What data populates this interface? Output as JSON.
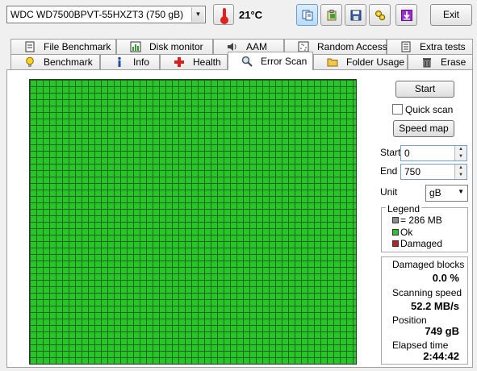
{
  "toolbar": {
    "drive": "WDC WD7500BPVT-55HXZT3 (750 gB)",
    "temperature": "21°C",
    "exit_label": "Exit"
  },
  "tabs_top": [
    {
      "label": "File Benchmark",
      "icon": "file-benchmark-icon"
    },
    {
      "label": "Disk monitor",
      "icon": "disk-monitor-icon"
    },
    {
      "label": "AAM",
      "icon": "speaker-icon"
    },
    {
      "label": "Random Access",
      "icon": "random-access-icon"
    },
    {
      "label": "Extra tests",
      "icon": "extra-tests-icon"
    }
  ],
  "tabs_bottom": [
    {
      "label": "Benchmark",
      "icon": "lightbulb-icon"
    },
    {
      "label": "Info",
      "icon": "info-icon"
    },
    {
      "label": "Health",
      "icon": "red-cross-icon"
    },
    {
      "label": "Error Scan",
      "icon": "magnifier-icon",
      "active": true
    },
    {
      "label": "Folder Usage",
      "icon": "folder-icon"
    },
    {
      "label": "Erase",
      "icon": "trash-icon"
    }
  ],
  "scan": {
    "start_button": "Start",
    "quick_scan_label": "Quick scan",
    "quick_scan_checked": false,
    "speed_map_button": "Speed map",
    "start_label": "Start",
    "start_value": "0",
    "end_label": "End",
    "end_value": "750",
    "unit_label": "Unit",
    "unit_value": "gB"
  },
  "legend": {
    "title": "Legend",
    "items": [
      {
        "label": "= 286 MB",
        "color": "#8c8c8c"
      },
      {
        "label": "Ok",
        "color": "#29c429"
      },
      {
        "label": "Damaged",
        "color": "#c02020"
      }
    ]
  },
  "stats": {
    "damaged_blocks_label": "Damaged blocks",
    "damaged_blocks_value": "0.0 %",
    "scanning_speed_label": "Scanning speed",
    "scanning_speed_value": "52.2 MB/s",
    "position_label": "Position",
    "position_value": "749 gB",
    "elapsed_label": "Elapsed time",
    "elapsed_value": "2:44:42"
  },
  "colors": {
    "block_ok": "#29c429",
    "grid_line": "#1a6a1a",
    "accent": "#6b9ed6"
  }
}
